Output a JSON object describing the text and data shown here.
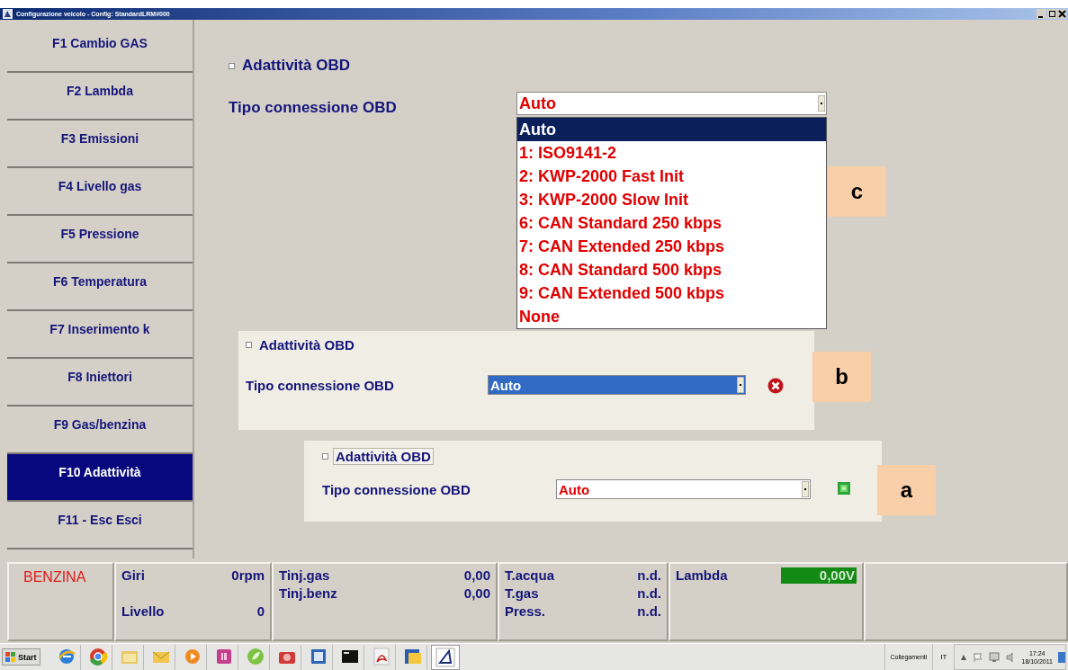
{
  "window": {
    "title": "Configurazione veicolo - Config: StandardLRM#000"
  },
  "sidebar": {
    "items": [
      {
        "label": "F1 Cambio GAS",
        "selected": false
      },
      {
        "label": "F2 Lambda",
        "selected": false
      },
      {
        "label": "F3 Emissioni",
        "selected": false
      },
      {
        "label": "F4 Livello gas",
        "selected": false
      },
      {
        "label": "F5 Pressione",
        "selected": false
      },
      {
        "label": "F6 Temperatura",
        "selected": false
      },
      {
        "label": "F7 Inserimento k",
        "selected": false
      },
      {
        "label": "F8 Iniettori",
        "selected": false
      },
      {
        "label": "F9 Gas/benzina",
        "selected": false
      },
      {
        "label": "F10 Adattività",
        "selected": true
      },
      {
        "label": "F11 - Esc Esci",
        "selected": false
      }
    ]
  },
  "panels": [
    {
      "badge": "c",
      "checkbox": {
        "label": "Adattività OBD",
        "checked": false,
        "focused": false
      },
      "field_label": "Tipo connessione OBD",
      "select": {
        "value": "Auto",
        "highlighted": false
      },
      "kind": "open",
      "options": [
        {
          "label": "Auto",
          "selected": true
        },
        {
          "label": "1: ISO9141-2",
          "selected": false
        },
        {
          "label": "2: KWP-2000 Fast Init",
          "selected": false
        },
        {
          "label": "3: KWP-2000 Slow Init",
          "selected": false
        },
        {
          "label": "6: CAN Standard 250 kbps",
          "selected": false
        },
        {
          "label": "7: CAN Extended 250 kbps",
          "selected": false
        },
        {
          "label": "8: CAN Standard 500 kbps",
          "selected": false
        },
        {
          "label": "9: CAN Extended 500 kbps",
          "selected": false
        },
        {
          "label": "None",
          "selected": false
        }
      ]
    },
    {
      "badge": "b",
      "checkbox": {
        "label": "Adattività OBD",
        "checked": false,
        "focused": false
      },
      "field_label": "Tipo connessione OBD",
      "select": {
        "value": "Auto",
        "highlighted": true
      },
      "kind": "error"
    },
    {
      "badge": "a",
      "checkbox": {
        "label": "Adattività OBD",
        "checked": false,
        "focused": true
      },
      "field_label": "Tipo connessione OBD",
      "select": {
        "value": "Auto",
        "highlighted": false
      },
      "kind": "ok"
    }
  ],
  "status_bar": {
    "mode": "BENZINA",
    "groups": [
      {
        "rows": [
          [
            "Giri",
            "0rpm"
          ],
          [
            "",
            ""
          ],
          [
            "Livello",
            "0"
          ]
        ]
      },
      {
        "rows": [
          [
            "Tinj.gas",
            "0,00"
          ],
          [
            "Tinj.benz",
            "0,00"
          ]
        ]
      },
      {
        "rows": [
          [
            "T.acqua",
            "n.d."
          ],
          [
            "T.gas",
            "n.d."
          ],
          [
            "Press.",
            "n.d."
          ]
        ]
      },
      {
        "rows": [
          [
            "Lambda",
            "0,00V"
          ]
        ],
        "meter": true
      }
    ]
  },
  "taskbar": {
    "start": "Start",
    "links": "Collegamenti",
    "language": "IT",
    "time": "17:24",
    "date": "18/10/2011"
  }
}
